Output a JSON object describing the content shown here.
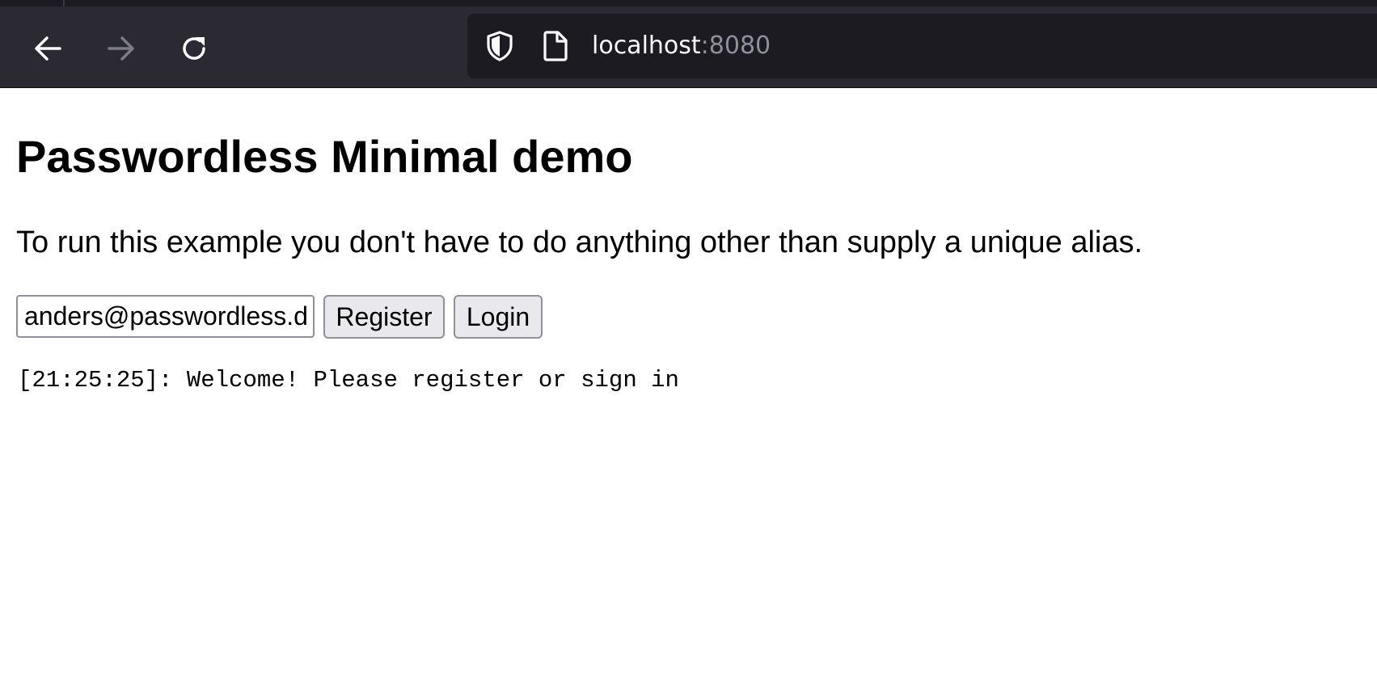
{
  "browser": {
    "url_host": "localhost",
    "url_port": ":8080",
    "icons": {
      "back": "arrow-left-icon",
      "forward": "arrow-right-icon",
      "reload": "reload-icon",
      "security": "shield-icon",
      "page": "page-icon"
    },
    "colors": {
      "toolbar": "#2b2a33",
      "urlbar": "#1c1b22",
      "url_text": "#fbfbfe",
      "url_port": "#8f8f9d"
    }
  },
  "page": {
    "title": "Passwordless Minimal demo",
    "intro": "To run this example you don't have to do anything other than supply a unique alias.",
    "alias_value": "anders@passwordless.dev",
    "register_label": "Register",
    "login_label": "Login",
    "log_line": "[21:25:25]: Welcome! Please register or sign in"
  }
}
